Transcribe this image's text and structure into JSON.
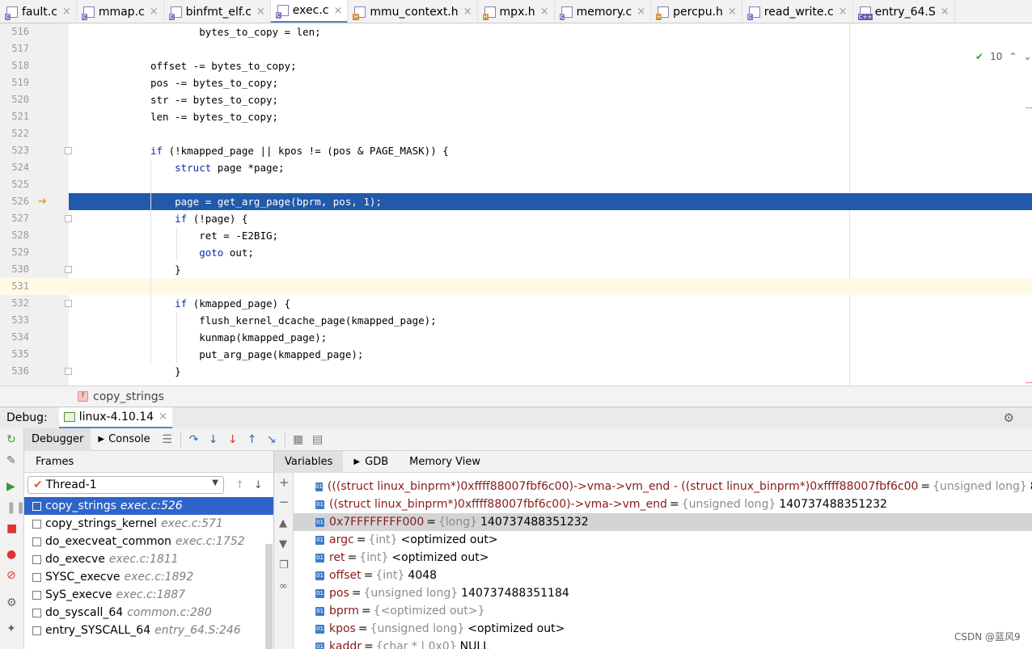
{
  "tabs": [
    {
      "label": "fault.c",
      "kind": "c"
    },
    {
      "label": "mmap.c",
      "kind": "c"
    },
    {
      "label": "binfmt_elf.c",
      "kind": "c"
    },
    {
      "label": "exec.c",
      "kind": "c",
      "active": true
    },
    {
      "label": "mmu_context.h",
      "kind": "h"
    },
    {
      "label": "mpx.h",
      "kind": "h"
    },
    {
      "label": "memory.c",
      "kind": "c"
    },
    {
      "label": "percpu.h",
      "kind": "h"
    },
    {
      "label": "read_write.c",
      "kind": "c"
    },
    {
      "label": "entry_64.S",
      "kind": "asm"
    }
  ],
  "editor": {
    "lines": [
      {
        "num": "516",
        "text": "        bytes_to_copy = len;"
      },
      {
        "num": "517",
        "text": ""
      },
      {
        "num": "518",
        "text": "offset -= bytes_to_copy;"
      },
      {
        "num": "519",
        "text": "pos -= bytes_to_copy;"
      },
      {
        "num": "520",
        "text": "str -= bytes_to_copy;"
      },
      {
        "num": "521",
        "text": "len -= bytes_to_copy;"
      },
      {
        "num": "522",
        "text": ""
      },
      {
        "num": "523",
        "text": "if (!kmapped_page || kpos != (pos & PAGE_MASK)) {"
      },
      {
        "num": "524",
        "text": "    struct page *page;"
      },
      {
        "num": "525",
        "text": ""
      },
      {
        "num": "526",
        "text": "    page = get_arg_page(bprm, pos, 1);"
      },
      {
        "num": "527",
        "text": "    if (!page) {"
      },
      {
        "num": "528",
        "text": "        ret = -E2BIG;"
      },
      {
        "num": "529",
        "text": "        goto out;"
      },
      {
        "num": "530",
        "text": "    }"
      },
      {
        "num": "531",
        "text": ""
      },
      {
        "num": "532",
        "text": "    if (kmapped_page) {"
      },
      {
        "num": "533",
        "text": "        flush_kernel_dcache_page(kmapped_page);"
      },
      {
        "num": "534",
        "text": "        kunmap(kmapped_page);"
      },
      {
        "num": "535",
        "text": "        put_arg_page(kmapped_page);"
      },
      {
        "num": "536",
        "text": "    }"
      }
    ],
    "highlight_line": "526",
    "caret_line": "531",
    "inspection_count": "10"
  },
  "breadcrumb": {
    "function": "copy_strings"
  },
  "debug": {
    "label": "Debug:",
    "config": "linux-4.10.14",
    "tabs": {
      "debugger": "Debugger",
      "console": "Console"
    }
  },
  "frames": {
    "header": "Frames",
    "thread": "Thread-1",
    "items": [
      {
        "name": "copy_strings",
        "loc": "exec.c:526"
      },
      {
        "name": "copy_strings_kernel",
        "loc": "exec.c:571"
      },
      {
        "name": "do_execveat_common",
        "loc": "exec.c:1752"
      },
      {
        "name": "do_execve",
        "loc": "exec.c:1811"
      },
      {
        "name": "SYSC_execve",
        "loc": "exec.c:1892"
      },
      {
        "name": "SyS_execve",
        "loc": "exec.c:1887"
      },
      {
        "name": "do_syscall_64",
        "loc": "common.c:280"
      },
      {
        "name": "entry_SYSCALL_64",
        "loc": "entry_64.S:246"
      }
    ]
  },
  "variables": {
    "tabs": {
      "variables": "Variables",
      "gdb": "GDB",
      "memory": "Memory View"
    },
    "items": [
      {
        "name": "(((struct linux_binprm*)0xffff88007fbf6c00)->vma->vm_end - ((struct linux_binprm*)0xffff88007fbf6c00",
        "type": "{unsigned long}",
        "value": "8"
      },
      {
        "name": "((struct linux_binprm*)0xffff88007fbf6c00)->vma->vm_end ",
        "type": "{unsigned long}",
        "value": "140737488351232"
      },
      {
        "name": "0x7FFFFFFFF000",
        "type": "{long}",
        "value": "140737488351232"
      },
      {
        "name": "argc",
        "type": "{int}",
        "value": "<optimized out>"
      },
      {
        "name": "ret",
        "type": "{int}",
        "value": "<optimized out>"
      },
      {
        "name": "offset",
        "type": "{int}",
        "value": "4048"
      },
      {
        "name": "pos",
        "type": "{unsigned long}",
        "value": "140737488351184"
      },
      {
        "name": "bprm",
        "type": "{<optimized out>}",
        "value": ""
      },
      {
        "name": "kpos",
        "type": "{unsigned long}",
        "value": "<optimized out>"
      },
      {
        "name": "kaddr",
        "type": "{char * | 0x0}",
        "value": "NULL"
      }
    ]
  },
  "watermark": "CSDN @蓝风9"
}
